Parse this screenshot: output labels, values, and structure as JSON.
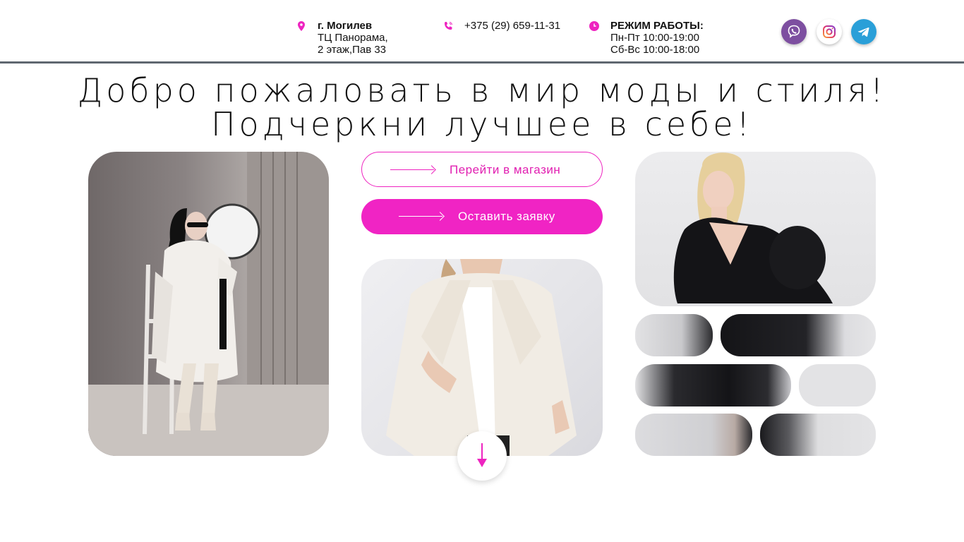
{
  "header": {
    "address": {
      "city": "г. Могилев",
      "line1": "ТЦ Панорама,",
      "line2": "2 этаж,Пав 33",
      "icon": "map-pin-icon"
    },
    "phone": {
      "number": "+375 (29) 659-11-31",
      "icon": "phone-icon"
    },
    "hours": {
      "label": "РЕЖИМ РАБОТЫ:",
      "weekdays": "Пн-Пт 10:00-19:00",
      "weekend": "Сб-Вс 10:00-18:00",
      "icon": "clock-icon"
    },
    "social": [
      {
        "name": "viber",
        "icon": "viber-icon",
        "color": "#7d4fa0"
      },
      {
        "name": "instagram",
        "icon": "instagram-icon",
        "color": "#e1306c"
      },
      {
        "name": "telegram",
        "icon": "telegram-icon",
        "color": "#2a9fd8"
      }
    ]
  },
  "hero": {
    "title_line1": "Добро пожаловать в мир моды и стиля!",
    "title_line2": "Подчеркни лучшее в себе!"
  },
  "buttons": {
    "shop": "Перейти в магазин",
    "request": "Оставить заявку"
  },
  "scroll": {
    "icon": "arrow-down-icon"
  },
  "colors": {
    "accent": "#f024c4",
    "header_border": "#5f6770",
    "text": "#111111"
  }
}
